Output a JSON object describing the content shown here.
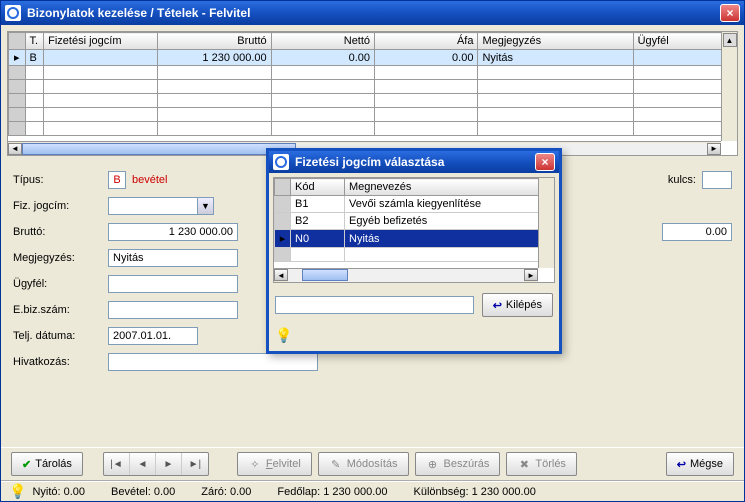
{
  "window": {
    "title": "Bizonylatok kezelése / Tételek - Felvitel"
  },
  "grid": {
    "headers": {
      "t": "T.",
      "jogcim": "Fizetési jogcím",
      "brutto": "Bruttó",
      "netto": "Nettó",
      "afa": "Áfa",
      "megj": "Megjegyzés",
      "ugyfel": "Ügyfél"
    },
    "row": {
      "t": "B",
      "jogcim": "",
      "brutto": "1 230 000.00",
      "netto": "0.00",
      "afa": "0.00",
      "megj": "Nyitás",
      "ugyfel": ""
    }
  },
  "form": {
    "tipus_label": "Típus:",
    "tipus_code": "B",
    "tipus_text": "bevétel",
    "fizjogcim_label": "Fiz. jogcím:",
    "fizjogcim_value": "",
    "brutto_label": "Bruttó:",
    "brutto_value": "1 230 000.00",
    "megj_label": "Megjegyzés:",
    "megj_value": "Nyitás",
    "ugyfel_label": "Ügyfél:",
    "ugyfel_value": "",
    "ebiz_label": "E.biz.szám:",
    "ebiz_value": "",
    "telj_label": "Telj. dátuma:",
    "telj_value": "2007.01.01.",
    "hivatk_label": "Hivatkozás:",
    "hivatk_value": "",
    "kulcs_label": "kulcs:",
    "kulcs_value": "",
    "afa_side_value": "0.00"
  },
  "toolbar": {
    "tarolas": "Tárolás",
    "felvitel": "Felvitel",
    "modositas": "Módosítás",
    "beszuras": "Beszúrás",
    "torles": "Törlés",
    "megse": "Mégse"
  },
  "status": {
    "nyito": "Nyitó: 0.00",
    "bevetel": "Bevétel: 0.00",
    "zaro": "Záró: 0.00",
    "fedolap": "Fedőlap: 1 230 000.00",
    "kulonbseg": "Különbség: 1 230 000.00"
  },
  "dialog": {
    "title": "Fizetési jogcím választása",
    "headers": {
      "kod": "Kód",
      "megn": "Megnevezés"
    },
    "rows": [
      {
        "kod": "B1",
        "megn": "Vevői számla kiegyenlítése",
        "sel": false
      },
      {
        "kod": "B2",
        "megn": "Egyéb befizetés",
        "sel": false
      },
      {
        "kod": "N0",
        "megn": "Nyitás",
        "sel": true
      }
    ],
    "search": "",
    "kilepes": "Kilépés"
  }
}
